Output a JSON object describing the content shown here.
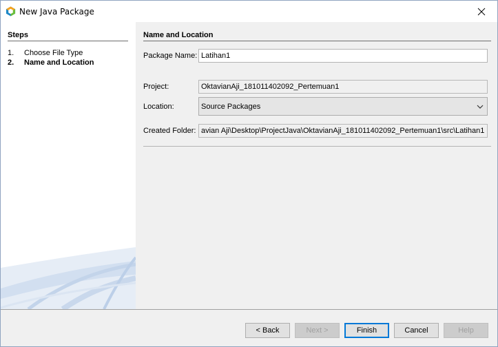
{
  "window": {
    "title": "New Java Package"
  },
  "steps": {
    "heading": "Steps",
    "items": [
      {
        "num": "1.",
        "label": "Choose File Type"
      },
      {
        "num": "2.",
        "label": "Name and Location"
      }
    ]
  },
  "main": {
    "section_title": "Name and Location",
    "package_name": {
      "label": "Package Name:",
      "value": "Latihan1"
    },
    "project": {
      "label": "Project:",
      "value": "OktavianAji_181011402092_Pertemuan1"
    },
    "location": {
      "label": "Location:",
      "value": "Source Packages"
    },
    "created_folder": {
      "label": "Created Folder:",
      "value": "avian Aji\\Desktop\\ProjectJava\\OktavianAji_181011402092_Pertemuan1\\src\\Latihan1"
    }
  },
  "buttons": {
    "back": "< Back",
    "next": "Next >",
    "finish": "Finish",
    "cancel": "Cancel",
    "help": "Help"
  },
  "colors": {
    "accent": "#0078d7",
    "panel_bg": "#f0f0f0"
  }
}
